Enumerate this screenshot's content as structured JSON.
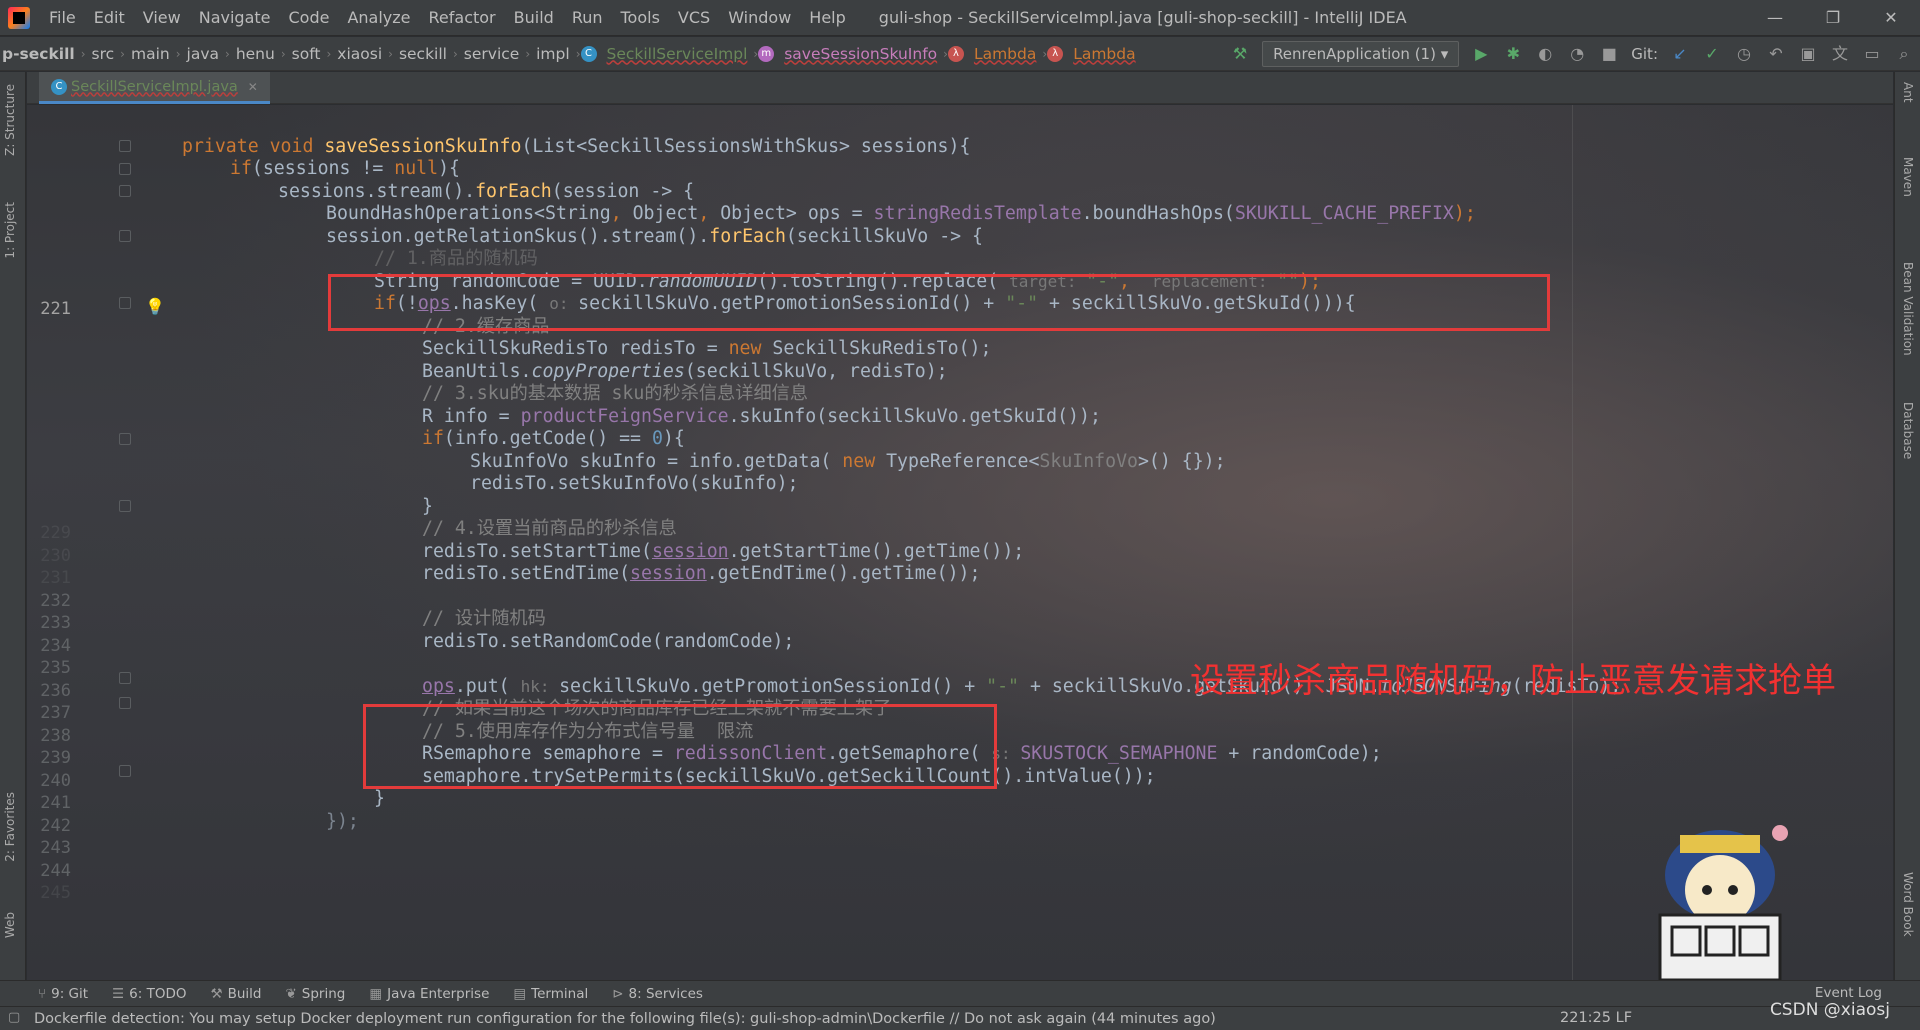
{
  "menu": {
    "items": [
      "File",
      "Edit",
      "View",
      "Navigate",
      "Code",
      "Analyze",
      "Refactor",
      "Build",
      "Run",
      "Tools",
      "VCS",
      "Window",
      "Help"
    ],
    "title": "guli-shop - SeckillServiceImpl.java [guli-shop-seckill] - IntelliJ IDEA"
  },
  "breadcrumb": {
    "items": [
      "p-seckill",
      "src",
      "main",
      "java",
      "henu",
      "soft",
      "xiaosi",
      "seckill",
      "service",
      "impl"
    ],
    "class": "SeckillServiceImpl",
    "method": "saveSessionSkuInfo",
    "lambda1": "Lambda",
    "lambda2": "Lambda"
  },
  "toolbar": {
    "run_config": "RenrenApplication (1)",
    "git_label": "Git:"
  },
  "editor": {
    "tab_name": "SeckillServiceImpl.java",
    "line_numbers": [
      "221",
      "232",
      "233",
      "234",
      "235",
      "236",
      "237",
      "238",
      "239",
      "240",
      "241",
      "242",
      "243",
      "244"
    ],
    "faded_line_numbers": [
      "229",
      "230",
      "231",
      "245"
    ]
  },
  "code": {
    "l1_kw": "private void ",
    "l1_fn": "saveSessionSkuInfo",
    "l1_rest": "(List<SeckillSessionsWithSkus> sessions){",
    "l2_kw": "if",
    "l2_a": "(sessions != ",
    "l2_null": "null",
    "l2_b": "){",
    "l3_a": "sessions.stream().",
    "l3_fn": "forEach",
    "l3_b": "(session -> {",
    "l4_a": "BoundHashOperations<String",
    "l4_c1": ", ",
    "l4_b": "Object",
    "l4_c2": ", ",
    "l4_c": "Object> ops = ",
    "l4_fld": "stringRedisTemplate",
    "l4_d": ".boundHashOps(",
    "l4_cst": "SKUKILL_CACHE_PREFIX",
    "l4_e": ");",
    "l5_a": "session.getRelationSkus().stream().",
    "l5_fn": "forEach",
    "l5_b": "(seckillSkuVo -> {",
    "l6_cmt": "// 1.商品的随机码",
    "l7_a": "String randomCode = UUID.",
    "l7_itl": "randomUUID",
    "l7_b": "().toString().replace( ",
    "l7_h1": "target: ",
    "l7_s1": "\"-\"",
    "l7_c": ",  ",
    "l7_h2": "replacement: ",
    "l7_s2": "\"\"",
    "l7_d": ");",
    "l8_kw": "if",
    "l8_a": "(!",
    "l8_ops": "ops",
    "l8_b": ".hasKey( ",
    "l8_h": "o: ",
    "l8_c": "seckillSkuVo.getPromotionSessionId() + ",
    "l8_s": "\"-\"",
    "l8_d": " + seckillSkuVo.getSkuId())){",
    "l9_cmt": "// 2.缓存商品",
    "l10_a": "SeckillSkuRedisTo redisTo = ",
    "l10_kw": "new ",
    "l10_b": "SeckillSkuRedisTo();",
    "l11_a": "BeanUtils.",
    "l11_itl": "copyProperties",
    "l11_b": "(seckillSkuVo, redisTo);",
    "l12_cmt": "// 3.sku的基本数据 sku的秒杀信息详细信息",
    "l13_a": "R info = ",
    "l13_fld": "productFeignService",
    "l13_b": ".skuInfo(seckillSkuVo.getSkuId());",
    "l14_kw": "if",
    "l14_a": "(info.getCode() == ",
    "l14_num": "0",
    "l14_b": "){",
    "l15_a": "SkuInfoVo skuInfo = info.getData( ",
    "l15_kw": "new ",
    "l15_b": "TypeReference<",
    "l15_gen": "SkuInfoVo",
    "l15_c": ">() {});",
    "l16_a": "redisTo.setSkuInfoVo(skuInfo);",
    "l17_a": "}",
    "l18_cmt": "// 4.设置当前商品的秒杀信息",
    "l19_a": "redisTo.setStartTime(",
    "l19_u": "session",
    "l19_b": ".getStartTime().getTime());",
    "l20_a": "redisTo.setEndTime(",
    "l20_u": "session",
    "l20_b": ".getEndTime().getTime());",
    "l21_cmt": "// 设计随机码",
    "l22_a": "redisTo.setRandomCode(randomCode);",
    "l23_ops": "ops",
    "l23_a": ".put( ",
    "l23_h": "hk: ",
    "l23_b": "seckillSkuVo.getPromotionSessionId() + ",
    "l23_s": "\"-\"",
    "l23_c": " + seckillSkuVo.getSkuId(), JSON.",
    "l23_itl": "toJSONString",
    "l23_d": "(redisTo);",
    "l24_cmt": "// 如果当前这个场次的商品库存已经上架就不需要上架了",
    "l25_cmt": "// 5.使用库存作为分布式信号量  限流",
    "l26_a": "RSemaphore semaphore = ",
    "l26_fld": "redissonClient",
    "l26_b": ".getSemaphore( ",
    "l26_h": "s: ",
    "l26_cst": "SKUSTOCK_SEMAPHONE",
    "l26_c": " + randomCode);",
    "l27_a": "semaphore.trySetPermits(seckillSkuVo.getSeckillCount().intValue());",
    "l28_a": "}",
    "l29_a": "});"
  },
  "annotation": "设置秒杀商品随机码，防止恶意发请求抢单",
  "left_tabs": [
    "Z: Structure",
    "1: Project",
    "2: Favorites",
    "Web"
  ],
  "right_tabs": [
    "Ant",
    "Maven",
    "Bean Validation",
    "Database",
    "Word Book"
  ],
  "bottom_tabs": [
    "9: Git",
    "6: TODO",
    "Build",
    "Spring",
    "Java Enterprise",
    "Terminal",
    "8: Services"
  ],
  "event_log": "Event Log",
  "status": {
    "message": "Dockerfile detection: You may setup Docker deployment run configuration for the following file(s): guli-shop-admin\\Dockerfile // Do not ask again (44 minutes ago)",
    "position": "221:25  LF"
  },
  "watermark": "CSDN @xiaosj",
  "colors": {
    "highlight_box": "#e33b3b",
    "annotation_text": "#f23131"
  }
}
